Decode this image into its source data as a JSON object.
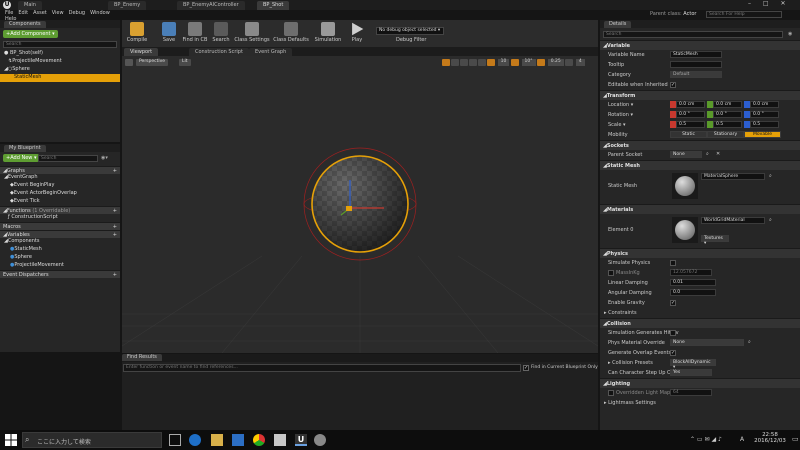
{
  "tabs": [
    "Main",
    "BP_Enemy",
    "BP_EnemyAIController",
    "BP_Shot"
  ],
  "header": {
    "parent_class_label": "Parent class:",
    "parent_class_value": "Actor",
    "search_help": "Search For Help"
  },
  "menu": [
    "File",
    "Edit",
    "Asset",
    "View",
    "Debug",
    "Window",
    "Help"
  ],
  "toolbar": {
    "compile": "Compile",
    "save": "Save",
    "find_cb": "Find in CB",
    "search": "Search",
    "class_settings": "Class Settings",
    "class_defaults": "Class Defaults",
    "simulation": "Simulation",
    "play": "Play",
    "debug_object": "No debug object selected ▾",
    "debug_filter": "Debug Filter"
  },
  "components": {
    "tab": "Components",
    "add": "+Add Component ▾",
    "search_placeholder": "Search",
    "self": "BP_Shot(self)",
    "items": [
      "ProjectileMovement",
      "Sphere",
      "StaticMesh"
    ]
  },
  "my_blueprint": {
    "tab": "My Blueprint",
    "add": "+Add New ▾",
    "search_placeholder": "Search",
    "graphs": "Graphs",
    "event_graph": "EventGraph",
    "events": [
      "Event BeginPlay",
      "Event ActorBeginOverlap",
      "Event Tick"
    ],
    "functions": "Functions",
    "functions_note": "(1 Overridable)",
    "construction": "ConstructionScript",
    "macros": "Macros",
    "variables": "Variables",
    "components_cat": "Components",
    "components": [
      "StaticMesh",
      "Sphere",
      "ProjectileMovement"
    ],
    "dispatchers": "Event Dispatchers"
  },
  "viewport": {
    "tabs": [
      "Viewport",
      "Construction Script",
      "Event Graph"
    ],
    "perspective": "Perspective",
    "lit": "Lit",
    "grid": "10",
    "rot": "10°",
    "scale": "0.25",
    "cam": "4"
  },
  "find": {
    "tab": "Find Results",
    "placeholder": "Enter function or event name to find references...",
    "checkbox": "Find in Current Blueprint Only"
  },
  "details": {
    "tab": "Details",
    "search_placeholder": "Search",
    "variable": {
      "title": "Variable",
      "name_label": "Variable Name",
      "name": "StaticMesh",
      "tooltip": "Tooltip",
      "category_label": "Category",
      "category": "Default",
      "editable": "Editable when Inherited"
    },
    "transform": {
      "title": "Transform",
      "location": "Location ▾",
      "rotation": "Rotation ▾",
      "scale": "Scale ▾",
      "mobility": "Mobility",
      "loc": [
        "0.0 cm",
        "0.0 cm",
        "0.0 cm"
      ],
      "rot": [
        "0.0 °",
        "0.0 °",
        "0.0 °"
      ],
      "scl": [
        "0.5",
        "0.5",
        "0.5"
      ],
      "mob": [
        "Static",
        "Stationary",
        "Movable"
      ]
    },
    "sockets": {
      "title": "Sockets",
      "parent": "Parent Socket",
      "none": "None"
    },
    "static_mesh": {
      "title": "Static Mesh",
      "label": "Static Mesh",
      "value": "MaterialSphere"
    },
    "materials": {
      "title": "Materials",
      "label": "Element 0",
      "value": "WorldGridMaterial",
      "textures": "Textures ▾"
    },
    "physics": {
      "title": "Physics",
      "simulate": "Simulate Physics",
      "mass": "MassInKg",
      "mass_val": "12.057672",
      "linear": "Linear Damping",
      "linear_val": "0.01",
      "angular": "Angular Damping",
      "angular_val": "0.0",
      "gravity": "Enable Gravity",
      "constraints": "Constraints"
    },
    "collision": {
      "title": "Collision",
      "sim_hit": "Simulation Generates Hit Ev",
      "phys_mat": "Phys Material Override",
      "phys_val": "None",
      "overlap": "Generate Overlap Events",
      "presets": "Collision Presets",
      "presets_val": "BlockAllDynamic ▾",
      "step": "Can Character Step Up On",
      "step_val": "Yes"
    },
    "lighting": {
      "title": "Lighting",
      "override": "Overridden Light Map Re",
      "override_val": "64",
      "lightmass": "Lightmass Settings"
    }
  },
  "taskbar": {
    "search": "ここに入力して検索",
    "time": "22:58",
    "date": "2016/12/03",
    "lang": "A"
  },
  "colors": {
    "accent": "#e5a008",
    "green": "#5e9d32",
    "x": "#c8392f",
    "y": "#5a9a2a",
    "z": "#2c5ecf"
  }
}
